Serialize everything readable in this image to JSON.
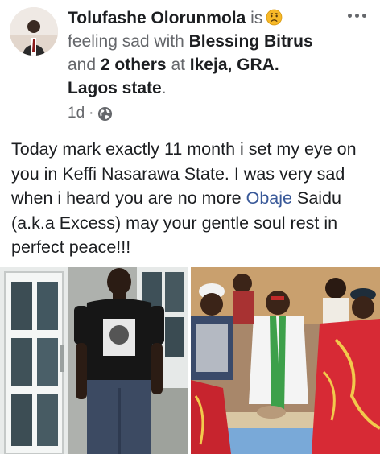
{
  "post": {
    "author": "Tolufashe Olorunmola",
    "is": "is",
    "feeling": "feeling sad",
    "with": "with",
    "tagged_person": "Blessing Bitrus",
    "and": "and",
    "others": "2 others",
    "at": "at",
    "location": "Ikeja, GRA. Lagos state",
    "period": ".",
    "time": "1d",
    "separator": "·",
    "privacy_icon": "globe-icon",
    "feeling_icon": "sad-face-emoji",
    "more_icon": "ellipsis-icon",
    "text_before_mention": "Today mark exactly 11 month i set my eye on you in Keffi Nasarawa State. I was very sad when i heard you are no more ",
    "mention": "Obaje",
    "text_after_mention": " Saidu (a.k.a Excess) may your gentle soul rest in perfect peace!!!"
  },
  "photos": [
    {
      "name": "man-in-black-tshirt-photo"
    },
    {
      "name": "group-ceremony-photo"
    }
  ],
  "colors": {
    "text": "#1c1e21",
    "secondary": "#65676b",
    "link": "#385898",
    "emoji": "#f7b928"
  }
}
